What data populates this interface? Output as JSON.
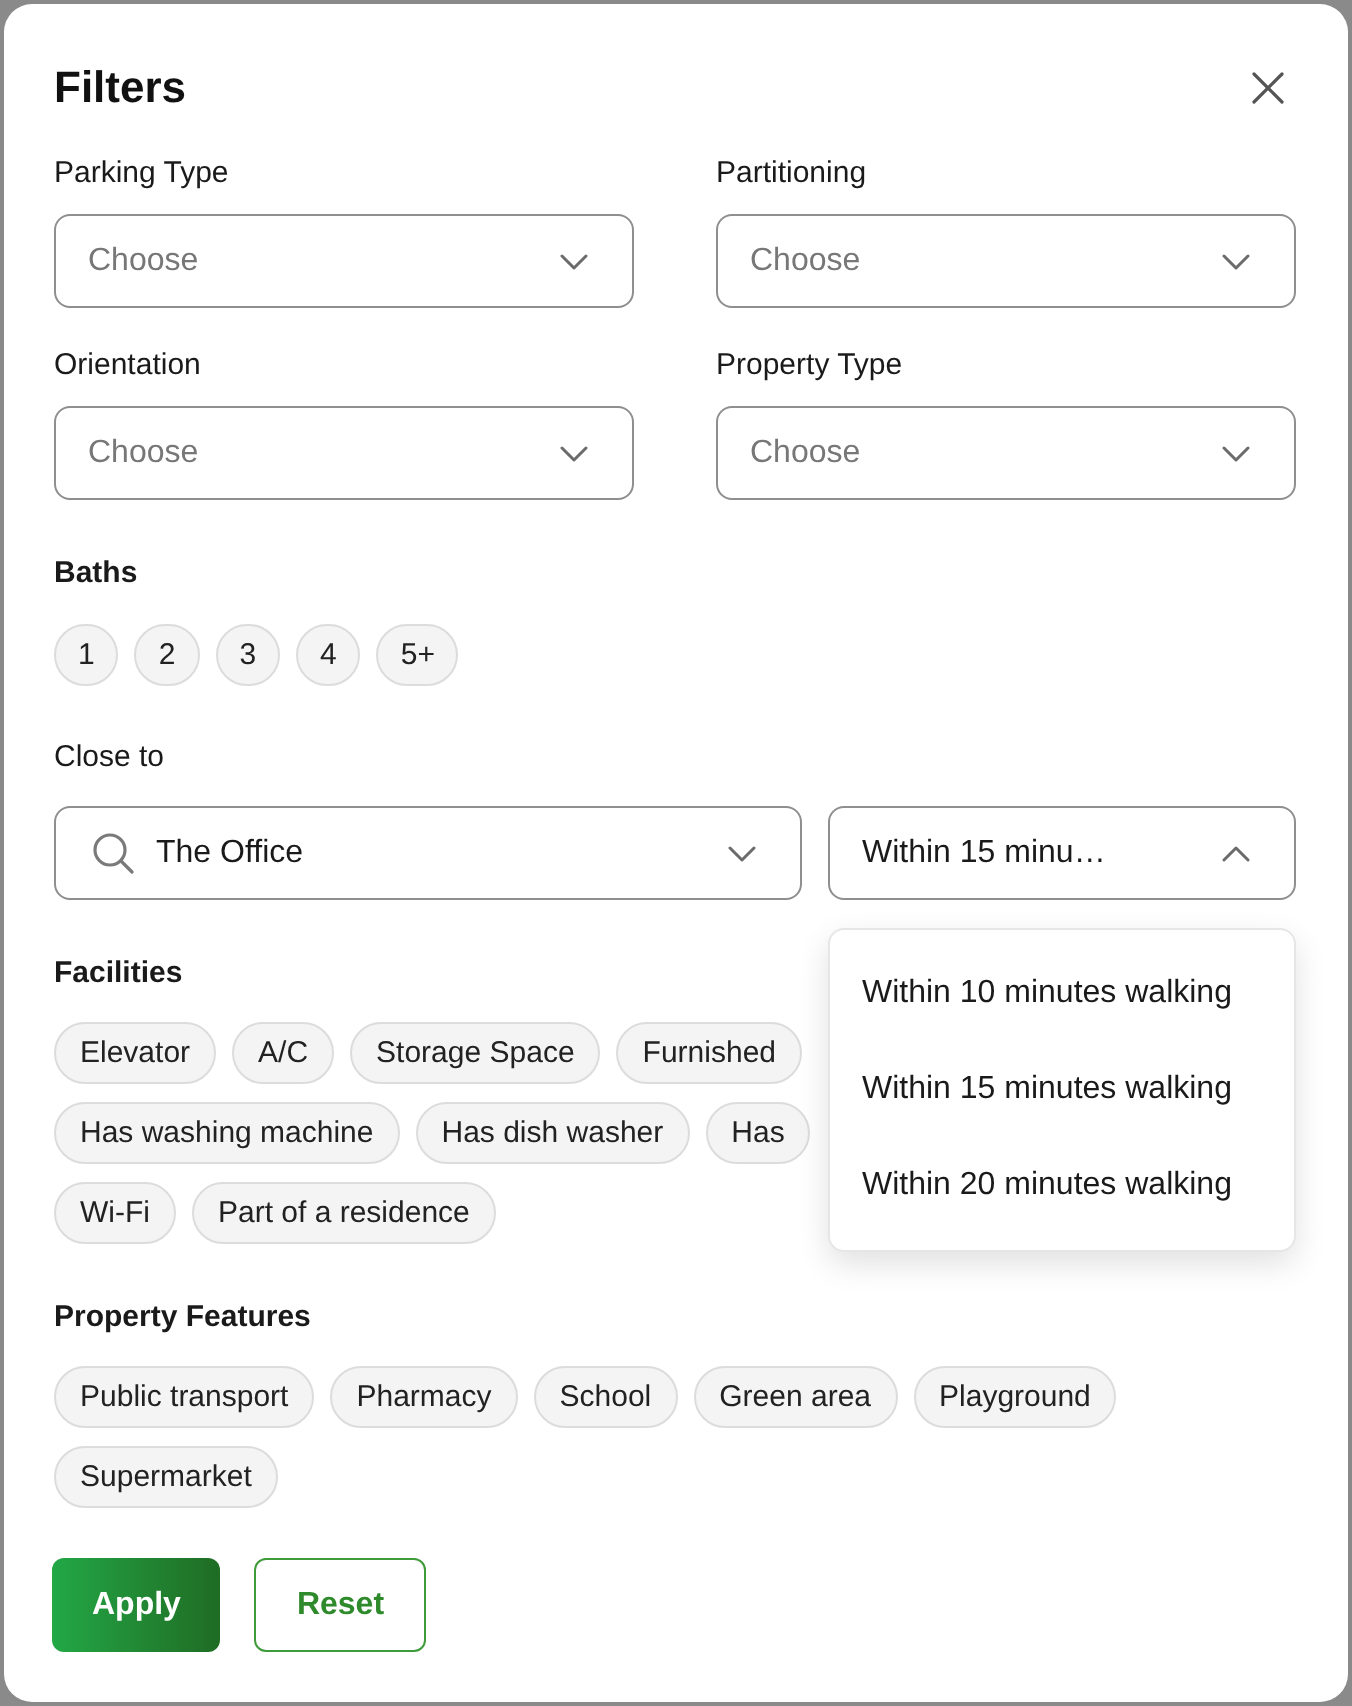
{
  "dialog": {
    "title": "Filters"
  },
  "dropdowns": [
    {
      "label": "Parking Type",
      "placeholder": "Choose",
      "expanded": false
    },
    {
      "label": "Partitioning",
      "placeholder": "Choose",
      "expanded": false
    },
    {
      "label": "Orientation",
      "placeholder": "Choose",
      "expanded": false
    },
    {
      "label": "Property Type",
      "placeholder": "Choose",
      "expanded": false
    }
  ],
  "baths": {
    "label": "Baths",
    "options": [
      {
        "label": "1",
        "selected": false
      },
      {
        "label": "2",
        "selected": false
      },
      {
        "label": "3",
        "selected": false
      },
      {
        "label": "4",
        "selected": false
      },
      {
        "label": "5+",
        "selected": false
      }
    ]
  },
  "close_to": {
    "label": "Close to",
    "place": {
      "value": "The Office",
      "expanded": false
    },
    "distance": {
      "value": "Within 15 minu…",
      "expanded": true,
      "options": [
        {
          "label": "Within 10 minutes walking",
          "selected": false
        },
        {
          "label": "Within 15 minutes walking",
          "selected": false
        },
        {
          "label": "Within 20 minutes walking",
          "selected": false
        }
      ]
    }
  },
  "facilities": {
    "label": "Facilities",
    "chips": [
      {
        "label": "Elevator",
        "selected": false
      },
      {
        "label": "A/C",
        "selected": false
      },
      {
        "label": "Storage Space",
        "selected": false
      },
      {
        "label": "Furnished",
        "selected": false
      },
      {
        "label": "Has washing machine",
        "selected": false
      },
      {
        "label": "Has dish washer",
        "selected": false
      },
      {
        "label": "Has",
        "selected": false
      },
      {
        "label": "Wi-Fi",
        "selected": false
      },
      {
        "label": "Part of a residence",
        "selected": false
      }
    ]
  },
  "property_features": {
    "label": "Property Features",
    "chips": [
      {
        "label": "Public transport",
        "selected": false
      },
      {
        "label": "Pharmacy",
        "selected": false
      },
      {
        "label": "School",
        "selected": false
      },
      {
        "label": "Green area",
        "selected": false
      },
      {
        "label": "Playground",
        "selected": false
      },
      {
        "label": "Supermarket",
        "selected": false
      }
    ]
  },
  "buttons": [
    {
      "label": "Apply",
      "kind": "primary"
    },
    {
      "label": "Reset",
      "kind": "secondary"
    }
  ]
}
